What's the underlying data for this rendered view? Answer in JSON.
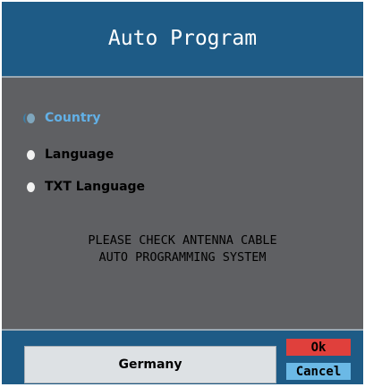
{
  "dialog": {
    "title": "Auto Program",
    "menu": [
      {
        "label": "Country",
        "selected": true
      },
      {
        "label": "Language",
        "selected": false
      },
      {
        "label": "TXT Language",
        "selected": false
      }
    ],
    "message_lines": [
      "PLEASE CHECK ANTENNA CABLE",
      "AUTO PROGRAMMING SYSTEM"
    ],
    "value": "Germany",
    "ok_label": "Ok",
    "cancel_label": "Cancel"
  },
  "colors": {
    "title_bar": "#1e5b86",
    "panel": "#5f6063",
    "selected_text": "#62b0e6",
    "ok_button": "#e0403c",
    "cancel_button": "#6bb9e6"
  }
}
